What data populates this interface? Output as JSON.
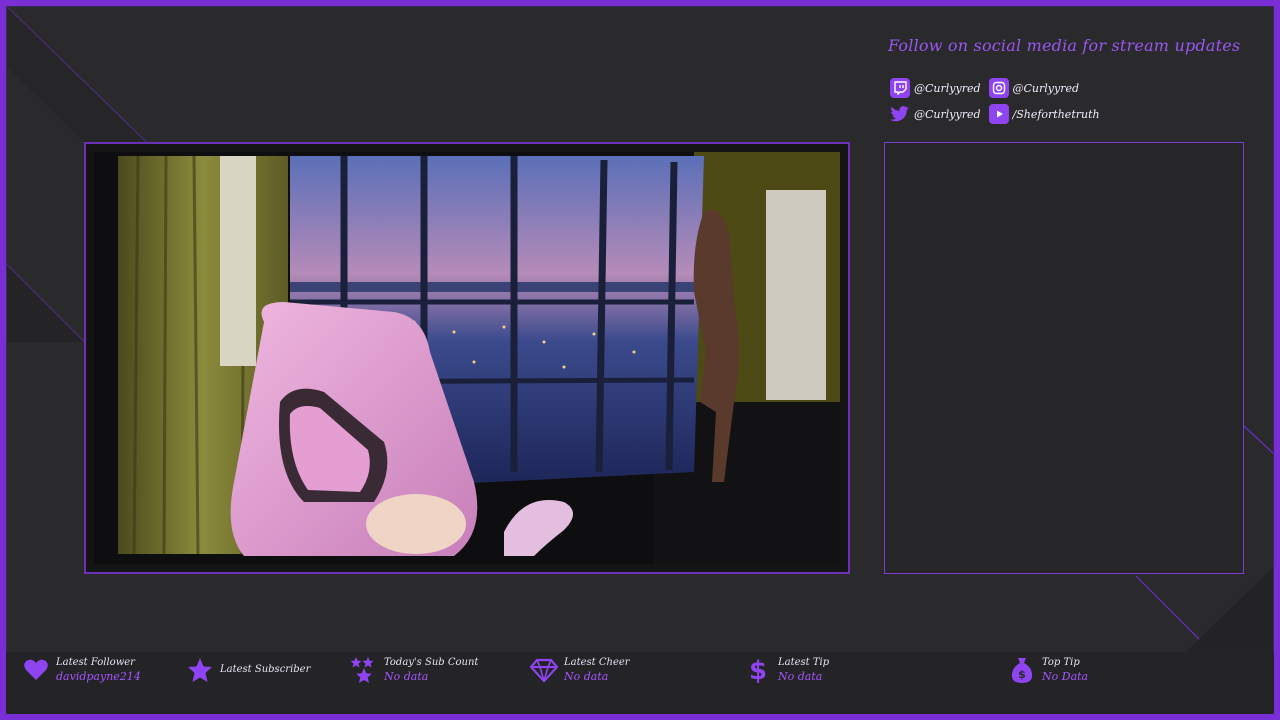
{
  "social": {
    "title": "Follow on social media for stream updates",
    "items": [
      {
        "icon": "twitch-icon",
        "handle": "@Curlyyred"
      },
      {
        "icon": "instagram-icon",
        "handle": "@Curlyyred"
      },
      {
        "icon": "twitter-icon",
        "handle": "@Curlyyred"
      },
      {
        "icon": "youtube-icon",
        "handle": "/Sheforthetruth"
      }
    ]
  },
  "stats": [
    {
      "icon": "heart-icon",
      "label": "Latest Follower",
      "value": "davidpayne214"
    },
    {
      "icon": "star-icon",
      "label": "Latest Subscriber",
      "value": ""
    },
    {
      "icon": "stars-icon",
      "label": "Today's Sub Count",
      "value": "No data"
    },
    {
      "icon": "diamond-icon",
      "label": "Latest Cheer",
      "value": "No data"
    },
    {
      "icon": "dollar-icon",
      "label": "Latest Tip",
      "value": "No data"
    },
    {
      "icon": "money-bag-icon",
      "label": "Top Tip",
      "value": "No Data"
    }
  ],
  "colors": {
    "accent": "#7a2fd6",
    "accent_light": "#a555ff",
    "background": "#2a2a2c"
  }
}
